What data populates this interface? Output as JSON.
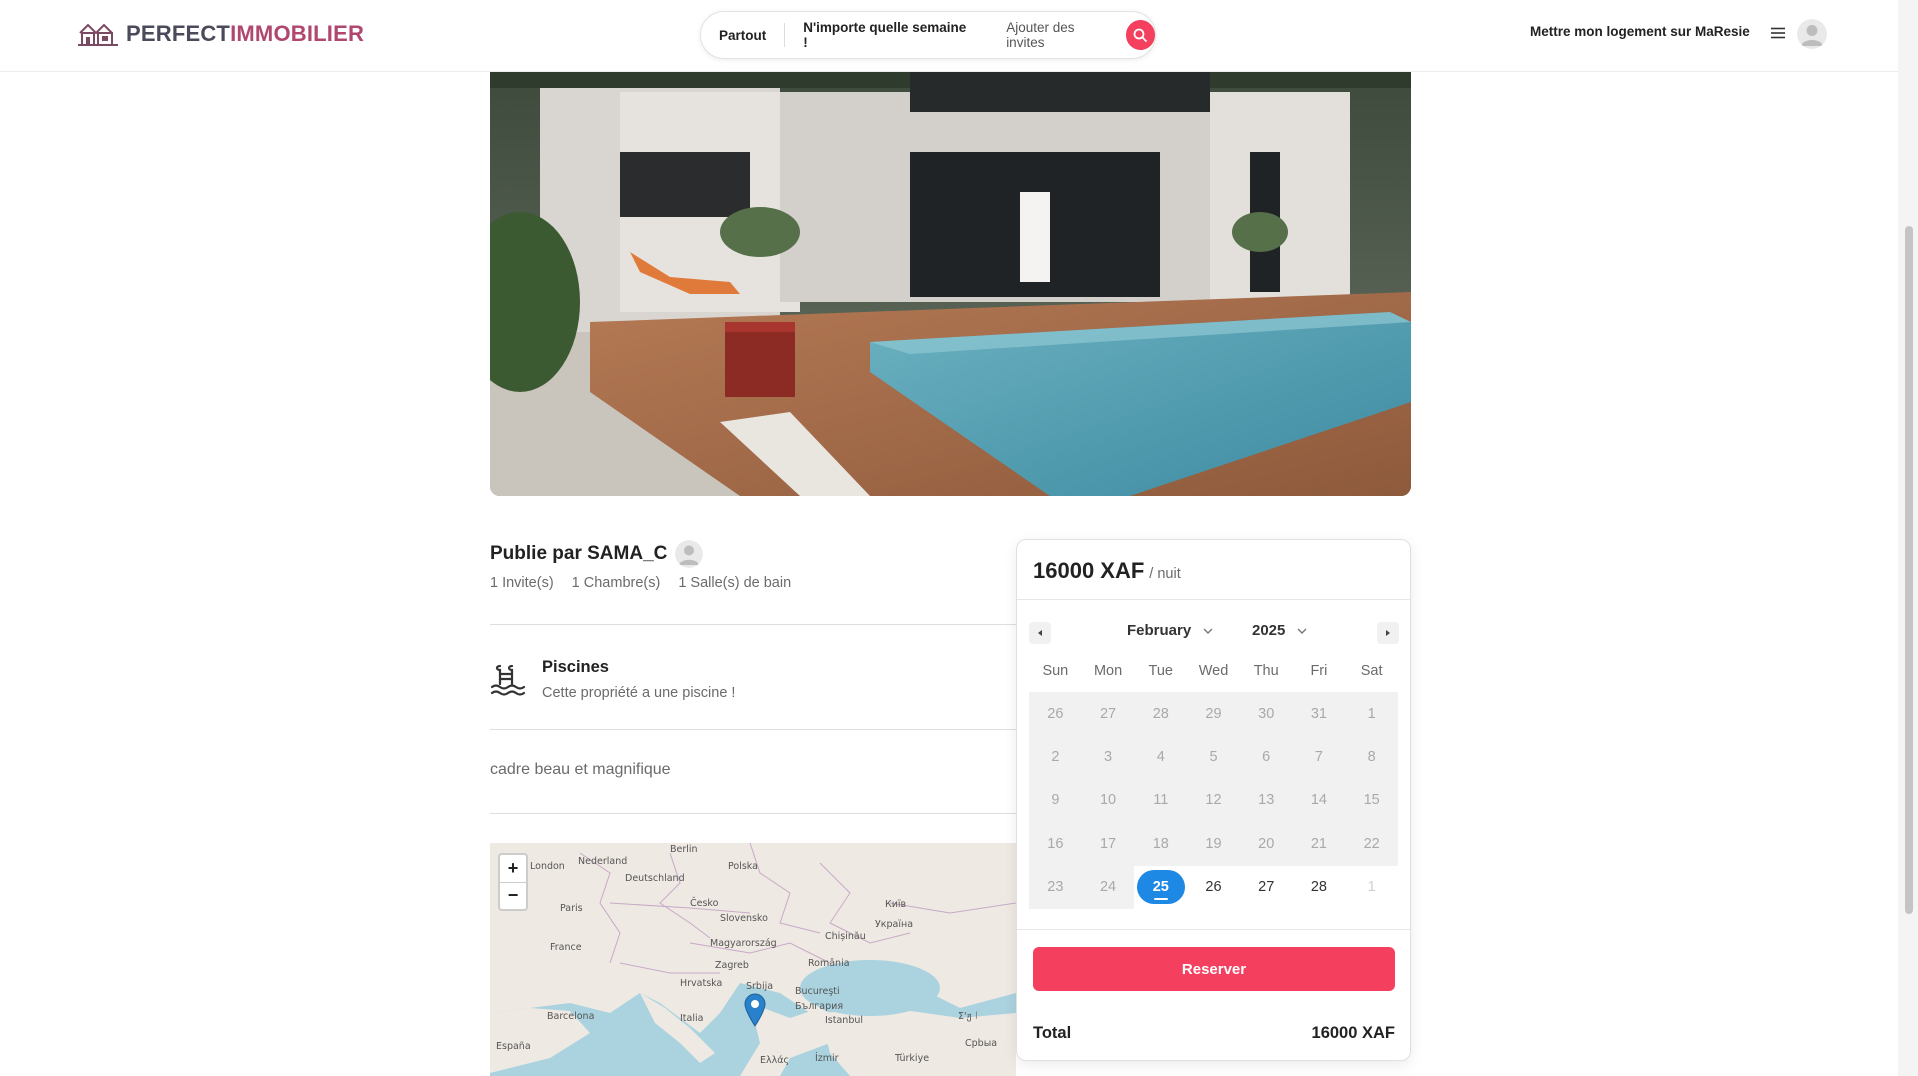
{
  "header": {
    "logo_part1": "PERFECT",
    "logo_part2": "IMMOBILIER",
    "logo_icon": "house-logo-icon",
    "search_location": "Partout",
    "search_week": "N'importe quelle semaine !",
    "search_guests": "Ajouter des invites",
    "host_link": "Mettre mon logement sur MaResie"
  },
  "listing": {
    "host_title": "Publie par SAMA_C",
    "stats": [
      "1 Invite(s)",
      "1 Chambre(s)",
      "1 Salle(s) de bain"
    ],
    "amenity_title": "Piscines",
    "amenity_desc": "Cette propriété a une piscine !",
    "amenity_icon": "pool-icon",
    "description": "cadre beau et magnifique"
  },
  "map": {
    "zoom_in": "+",
    "zoom_out": "−",
    "labels": [
      "London",
      "Nederland",
      "Berlin",
      "Deutschland",
      "Polska",
      "Paris",
      "Česko",
      "Slovensko",
      "Київ",
      "Україна",
      "France",
      "Magyarország",
      "Chișinău",
      "Zagreb",
      "România",
      "Hrvatska",
      "Srbija",
      "Bucureşti",
      "България",
      "Barcelona",
      "Italia",
      "Istanbul",
      "España",
      "Ελλάς",
      "İzmir",
      "Türkiye",
      "Σ'ჟ㆐",
      "Cpbыa"
    ]
  },
  "booking": {
    "price": "16000 XAF",
    "price_unit": "/ nuit",
    "month": "February",
    "year": "2025",
    "weekdays": [
      "Sun",
      "Mon",
      "Tue",
      "Wed",
      "Thu",
      "Fri",
      "Sat"
    ],
    "days": [
      {
        "d": "26",
        "s": "dis"
      },
      {
        "d": "27",
        "s": "dis"
      },
      {
        "d": "28",
        "s": "dis"
      },
      {
        "d": "29",
        "s": "dis"
      },
      {
        "d": "30",
        "s": "dis"
      },
      {
        "d": "31",
        "s": "dis"
      },
      {
        "d": "1",
        "s": "dis"
      },
      {
        "d": "2",
        "s": "dis"
      },
      {
        "d": "3",
        "s": "dis"
      },
      {
        "d": "4",
        "s": "dis"
      },
      {
        "d": "5",
        "s": "dis"
      },
      {
        "d": "6",
        "s": "dis"
      },
      {
        "d": "7",
        "s": "dis"
      },
      {
        "d": "8",
        "s": "dis"
      },
      {
        "d": "9",
        "s": "dis"
      },
      {
        "d": "10",
        "s": "dis"
      },
      {
        "d": "11",
        "s": "dis"
      },
      {
        "d": "12",
        "s": "dis"
      },
      {
        "d": "13",
        "s": "dis"
      },
      {
        "d": "14",
        "s": "dis"
      },
      {
        "d": "15",
        "s": "dis"
      },
      {
        "d": "16",
        "s": "dis"
      },
      {
        "d": "17",
        "s": "dis"
      },
      {
        "d": "18",
        "s": "dis"
      },
      {
        "d": "19",
        "s": "dis"
      },
      {
        "d": "20",
        "s": "dis"
      },
      {
        "d": "21",
        "s": "dis"
      },
      {
        "d": "22",
        "s": "dis"
      },
      {
        "d": "23",
        "s": "dis"
      },
      {
        "d": "24",
        "s": "dis"
      },
      {
        "d": "25",
        "s": "sel"
      },
      {
        "d": "26",
        "s": "ok"
      },
      {
        "d": "27",
        "s": "ok"
      },
      {
        "d": "28",
        "s": "ok"
      },
      {
        "d": "1",
        "s": "out"
      }
    ],
    "reserve_label": "Reserver",
    "total_label": "Total",
    "total_value": "16000 XAF"
  },
  "colors": {
    "accent": "#f43f5e",
    "selected_day": "#1e88e5",
    "logo_primary": "#4a4a5a",
    "logo_secondary": "#b0476f"
  }
}
